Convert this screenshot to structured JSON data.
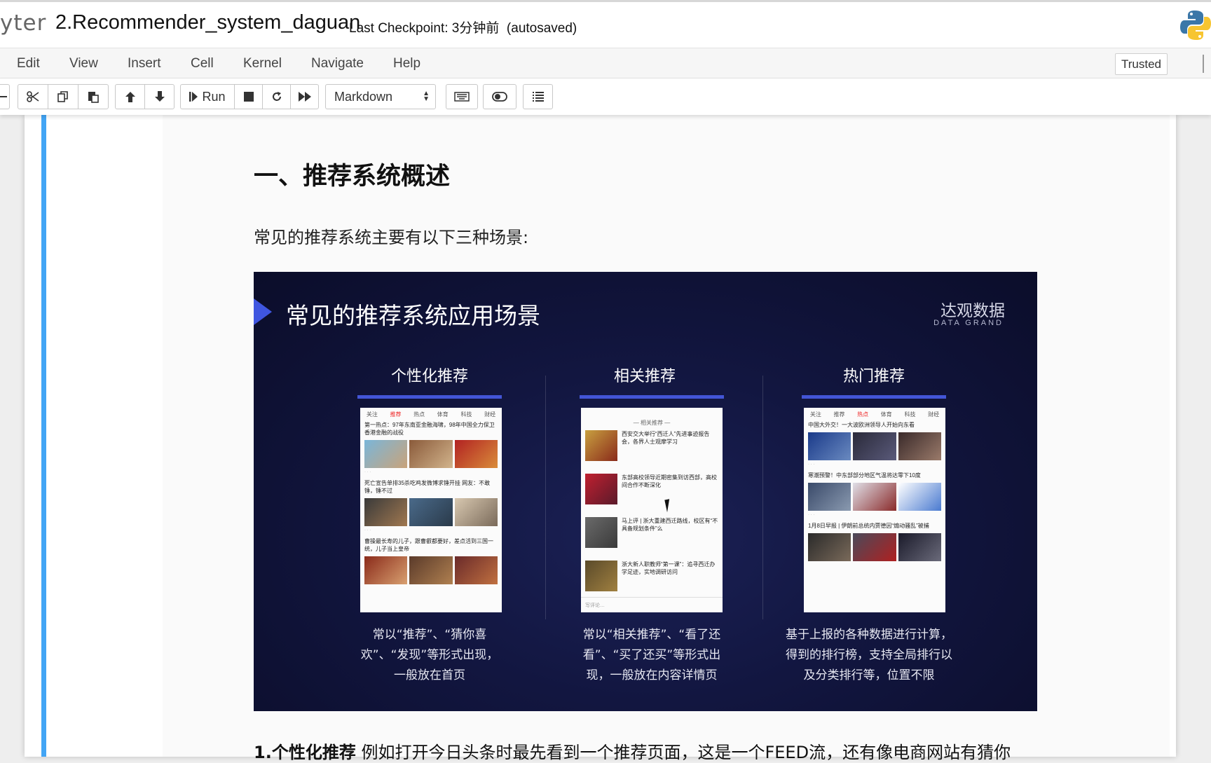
{
  "header": {
    "logo_fragment": "yter",
    "notebook_name": "2.Recommender_system_daguan",
    "checkpoint_text": "Last Checkpoint: 3分钟前  (autosaved)"
  },
  "menubar": {
    "items": [
      "Edit",
      "View",
      "Insert",
      "Cell",
      "Kernel",
      "Navigate",
      "Help"
    ],
    "trusted_label": "Trusted"
  },
  "toolbar": {
    "run_label": "Run",
    "cell_type": "Markdown"
  },
  "cell": {
    "heading": "一、推荐系统概述",
    "intro": "常见的推荐系统主要有以下三种场景:",
    "bottom_bold": "1.个性化推荐",
    "bottom_text": " 例如打开今日头条时最先看到一个推荐页面，这是一个FEED流，还有像电商网站有猜你"
  },
  "slide": {
    "title": "常见的推荐系统应用场景",
    "brand_cn": "达观数据",
    "brand_en": "DATA GRAND",
    "columns": [
      {
        "title": "个性化推荐",
        "desc": [
          "常以“推荐”、“猜你喜",
          "欢”、“发现”等形式出现，",
          "一般放在首页"
        ],
        "tabs": [
          "关注",
          "推荐",
          "热点",
          "体育",
          "科技",
          "财经"
        ],
        "active_tab": 1,
        "news": [
          "第一热点：97年东南亚金融海啸，98年中国全力保卫香港金融的战役",
          "死亡宣告单排35杀吃鸡发微博求锤开挂 网友：不敢锤，锤不过",
          "曹操最长寿的儿子，跟曹叡都要好，差点活到三国一统，儿子当上皇帝"
        ]
      },
      {
        "title": "相关推荐",
        "desc": [
          "常以“相关推荐”、“看了还",
          "看”、“买了还买”等形式出",
          "现，一般放在内容详情页"
        ],
        "head": "— 相关推荐 —",
        "news": [
          "西安交大举行“西迁人”先进事迹报告会，各界人士观摩学习",
          "东部高校领导近期密集到访西部，高校间合作不断深化",
          "马上评 | 浙大重建西迁路线，校区有“不具备规划条件”么",
          "浙大新人职教师“第一课”：追寻西迁办学足迹，实地调研访问"
        ],
        "footer": "写评论…"
      },
      {
        "title": "热门推荐",
        "desc": [
          "基于上报的各种数据进行计算，",
          "得到的排行榜，支持全局排行以",
          "及分类排行等，位置不限"
        ],
        "tabs": [
          "关注",
          "推荐",
          "热点",
          "体育",
          "科技",
          "财经"
        ],
        "active_tab": 2,
        "news": [
          "中国大外交！一大波欧洲领导人开始向东看",
          "寒潮预警！中东部部分地区气温将达零下10度",
          "1月8日早报 | 伊朗前总统内贾德因“煽动骚乱”被捕"
        ]
      }
    ]
  },
  "colors": {
    "cell_bar": "#42a5f5",
    "slide_bg": "#121640",
    "slide_accent": "#4355d6"
  }
}
